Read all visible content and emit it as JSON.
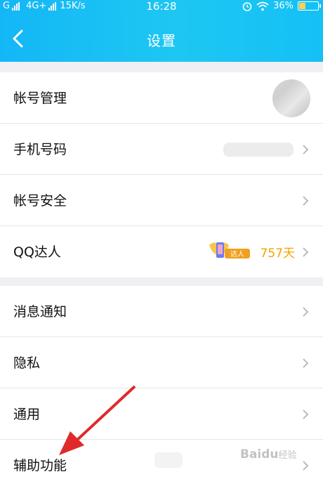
{
  "status": {
    "left_text": "G",
    "network": "4G+",
    "speed": "15K/s",
    "time": "16:28",
    "battery": "36%",
    "battery_level": 0.36
  },
  "header": {
    "title": "设置"
  },
  "group1": [
    {
      "label": "帐号管理"
    },
    {
      "label": "手机号码"
    },
    {
      "label": "帐号安全"
    },
    {
      "label": "QQ达人",
      "badge": "达人",
      "days": "757天"
    }
  ],
  "group2": [
    {
      "label": "消息通知"
    },
    {
      "label": "隐私"
    },
    {
      "label": "通用"
    },
    {
      "label": "辅助功能"
    }
  ],
  "watermark": {
    "brand": "Baidu",
    "sub": "经验"
  },
  "colors": {
    "header": "#13b7f6",
    "arrow": "#e02a2a",
    "days": "#f0a500"
  }
}
